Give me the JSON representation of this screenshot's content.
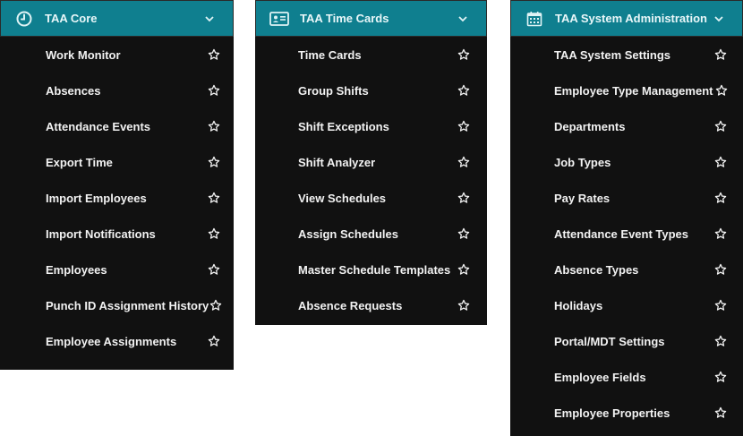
{
  "colors": {
    "header_bg": "#0f7f8f",
    "panel_bg": "#111111",
    "text": "#f2f2f2"
  },
  "panels": [
    {
      "title": "TAA Core",
      "icon": "clock-icon",
      "items": [
        "Work Monitor",
        "Absences",
        "Attendance Events",
        "Export Time",
        "Import Employees",
        "Import Notifications",
        "Employees",
        "Punch ID Assignment History",
        "Employee Assignments"
      ]
    },
    {
      "title": "TAA Time Cards",
      "icon": "id-card-icon",
      "items": [
        "Time Cards",
        "Group Shifts",
        "Shift Exceptions",
        "Shift Analyzer",
        "View Schedules",
        "Assign Schedules",
        "Master Schedule Templates",
        "Absence Requests"
      ]
    },
    {
      "title": "TAA System Administration",
      "icon": "calendar-icon",
      "items": [
        "TAA System Settings",
        "Employee Type Management",
        "Departments",
        "Job Types",
        "Pay Rates",
        "Attendance Event Types",
        "Absence Types",
        "Holidays",
        "Portal/MDT Settings",
        "Employee Fields",
        "Employee Properties"
      ]
    }
  ]
}
